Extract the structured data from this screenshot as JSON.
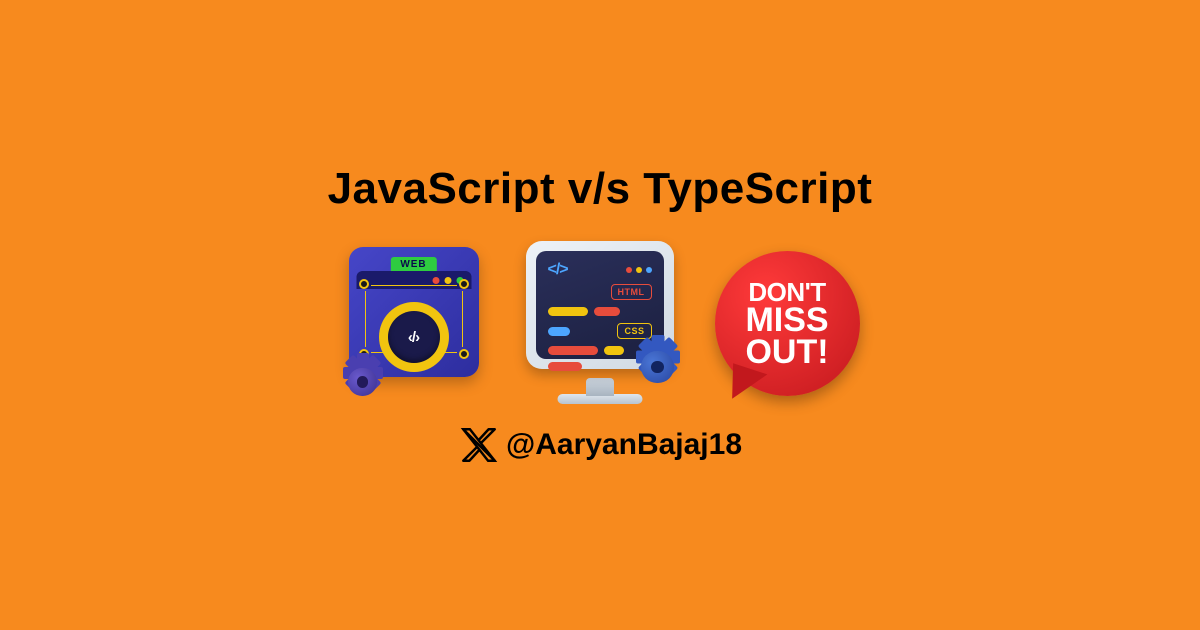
{
  "title": "JavaScript v/s TypeScript",
  "icons": {
    "web": {
      "tab_label": "WEB",
      "center_symbol": "‹/›"
    },
    "monitor": {
      "code_symbol": "</>",
      "badge_html": "HTML",
      "badge_css": "CSS"
    },
    "bubble": {
      "line1": "DON'T",
      "line2": "MISS",
      "line3": "OUT!"
    }
  },
  "social": {
    "handle": "@AaryanBajaj18"
  },
  "colors": {
    "background": "#F78A1E",
    "bubble": "#D11A1F"
  }
}
